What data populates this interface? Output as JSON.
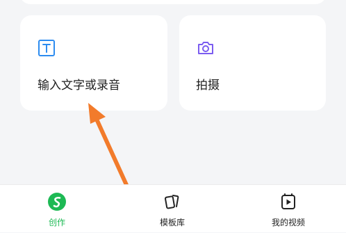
{
  "cards": [
    {
      "label": "输入文字或录音",
      "icon": "text-T-icon"
    },
    {
      "label": "拍摄",
      "icon": "camera-icon"
    }
  ],
  "tabbar": {
    "items": [
      {
        "label": "创作",
        "icon": "create-s-icon",
        "active": true
      },
      {
        "label": "模板库",
        "icon": "template-cards-icon",
        "active": false
      },
      {
        "label": "我的视频",
        "icon": "play-video-icon",
        "active": false
      }
    ]
  },
  "colors": {
    "accent": "#1db954",
    "card_icon_blue": "#2d8cf0",
    "card_icon_purple": "#7b5cf0",
    "arrow": "#f27b2b",
    "background": "#f4f5f7"
  }
}
